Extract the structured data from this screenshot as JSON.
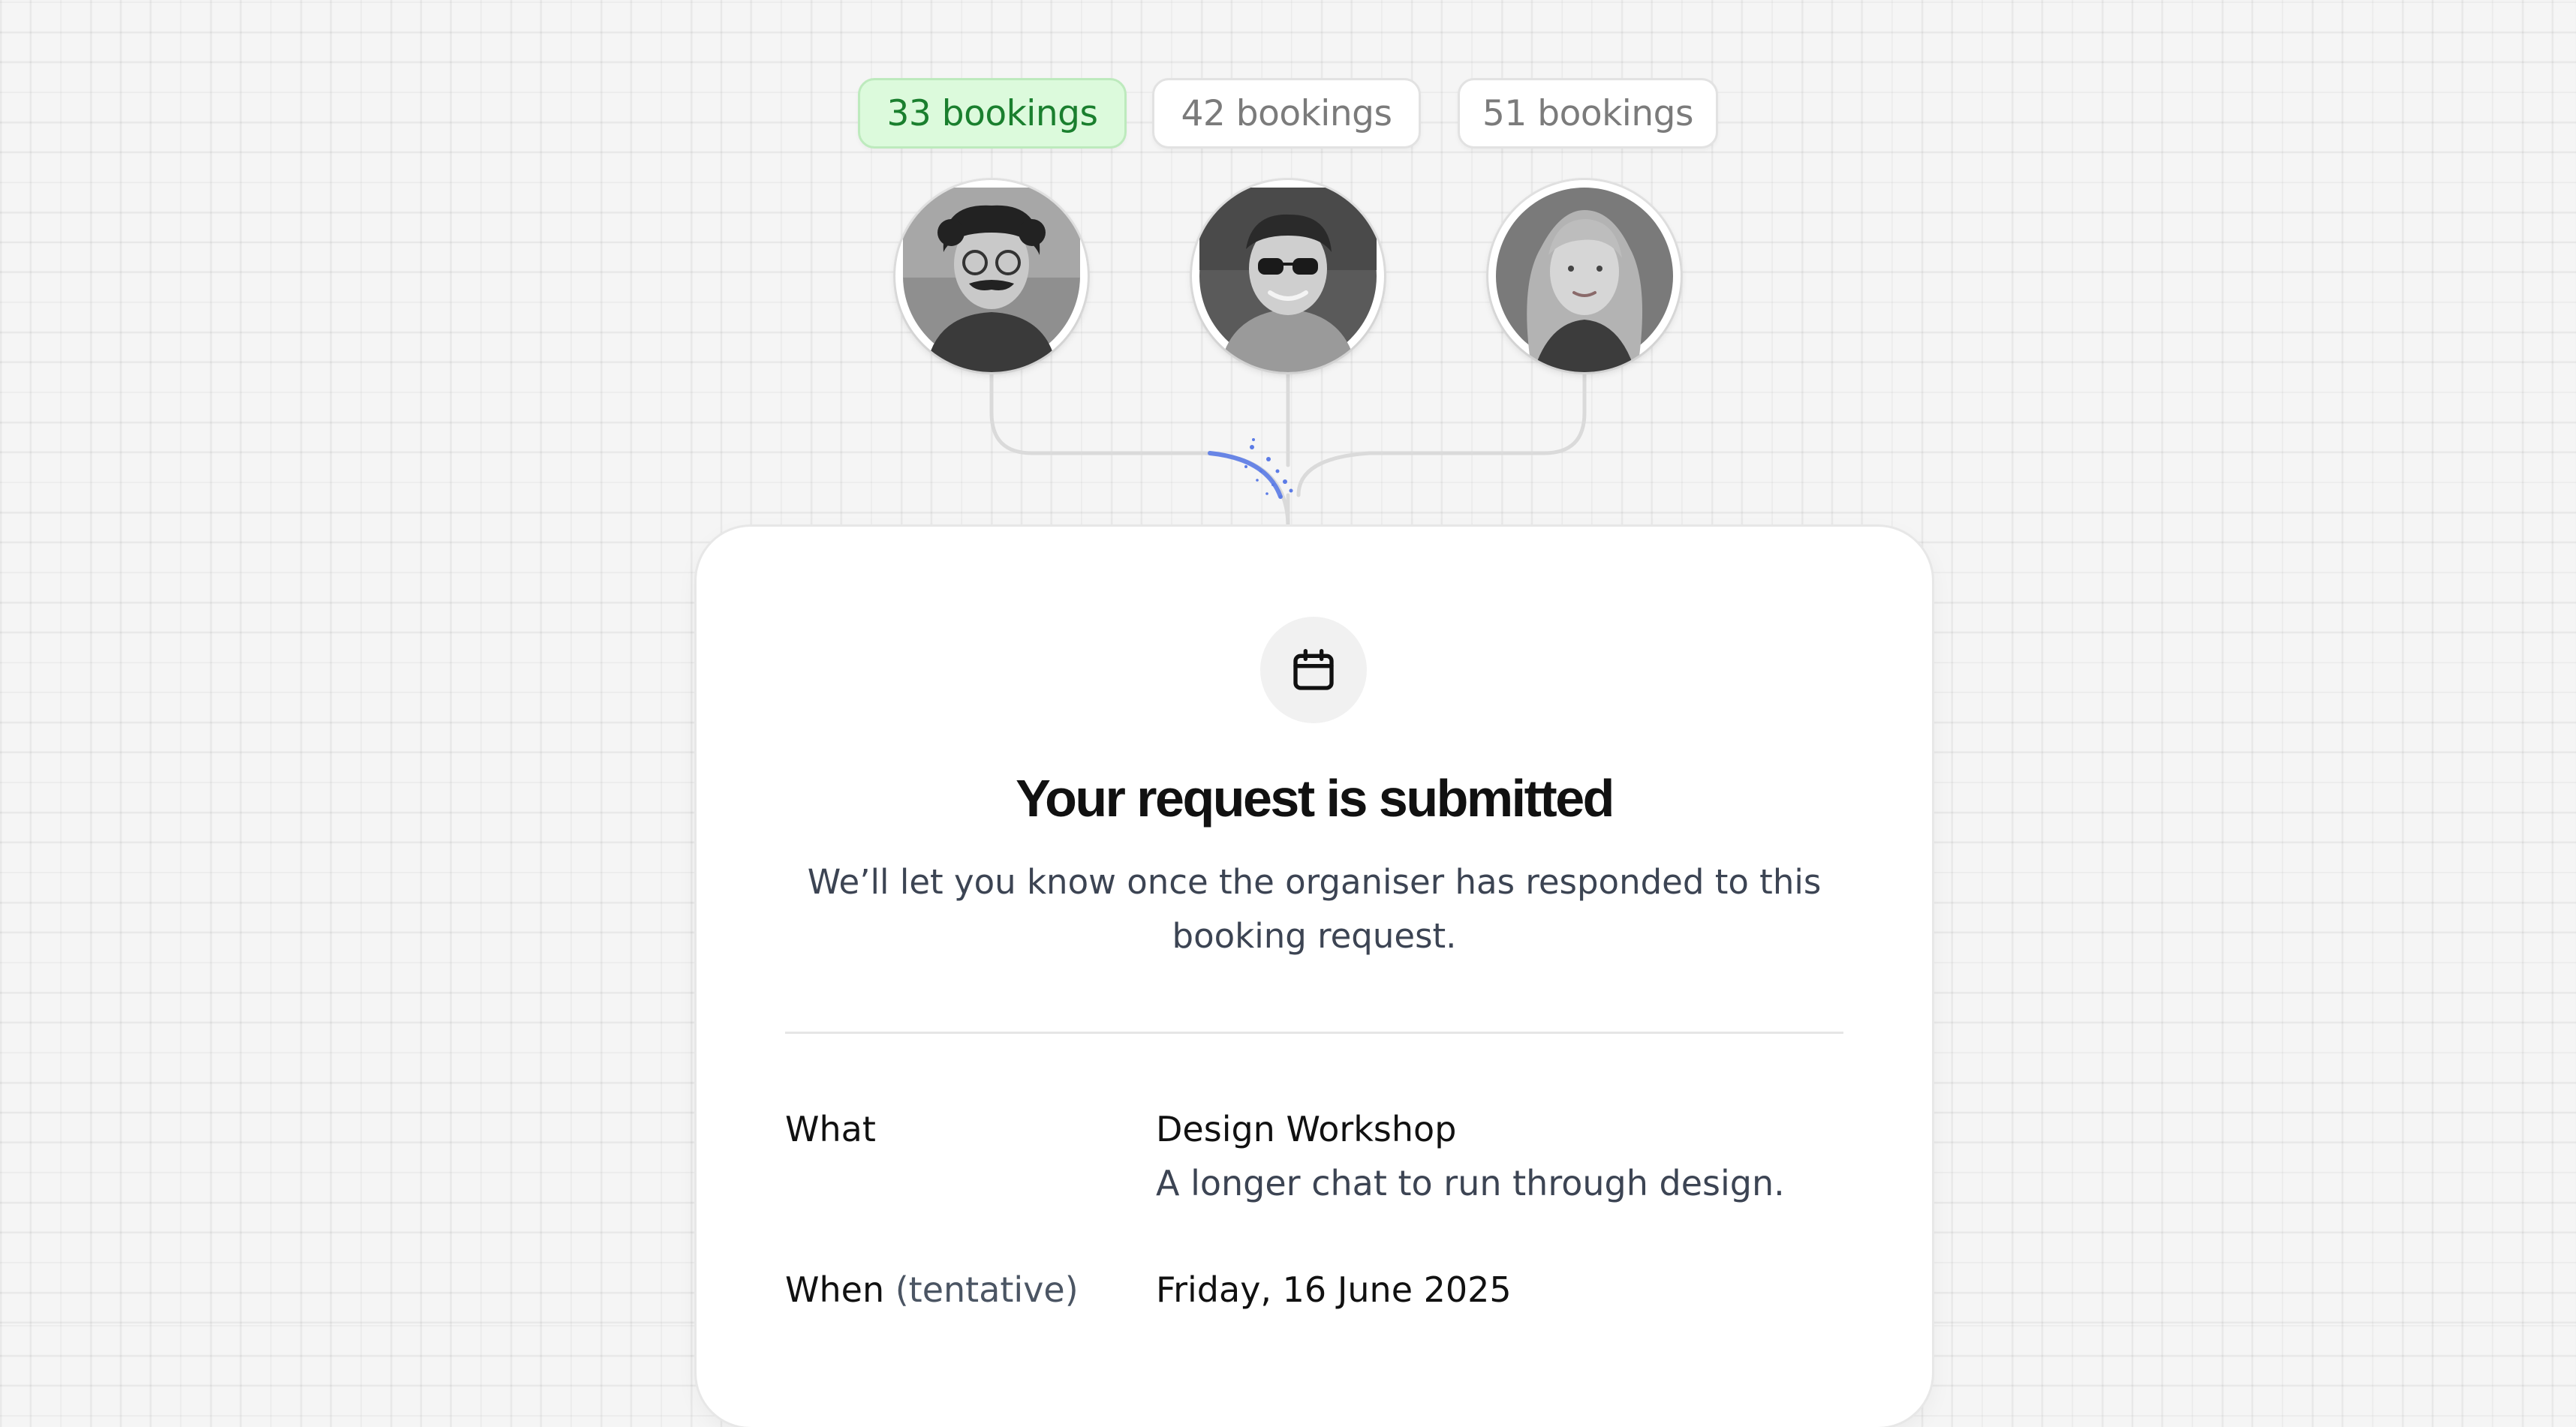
{
  "team": [
    {
      "bookings_label": "33 bookings",
      "selected": true
    },
    {
      "bookings_label": "42 bookings",
      "selected": false
    },
    {
      "bookings_label": "51 bookings",
      "selected": false
    }
  ],
  "card": {
    "icon": "calendar-icon",
    "title": "Your request is submitted",
    "subtitle": "We’ll let you know once the organiser has responded to this booking request.",
    "details": {
      "what_label": "What",
      "event_name": "Design Workshop",
      "event_description": "A longer chat to run through design.",
      "when_label": "When",
      "when_qualifier": "(tentative)",
      "date": "Friday, 16 June 2025"
    }
  },
  "colors": {
    "accent_blue": "#5b7be6",
    "selected_badge_bg": "#dcfadc",
    "selected_badge_text": "#1a7f2e"
  }
}
